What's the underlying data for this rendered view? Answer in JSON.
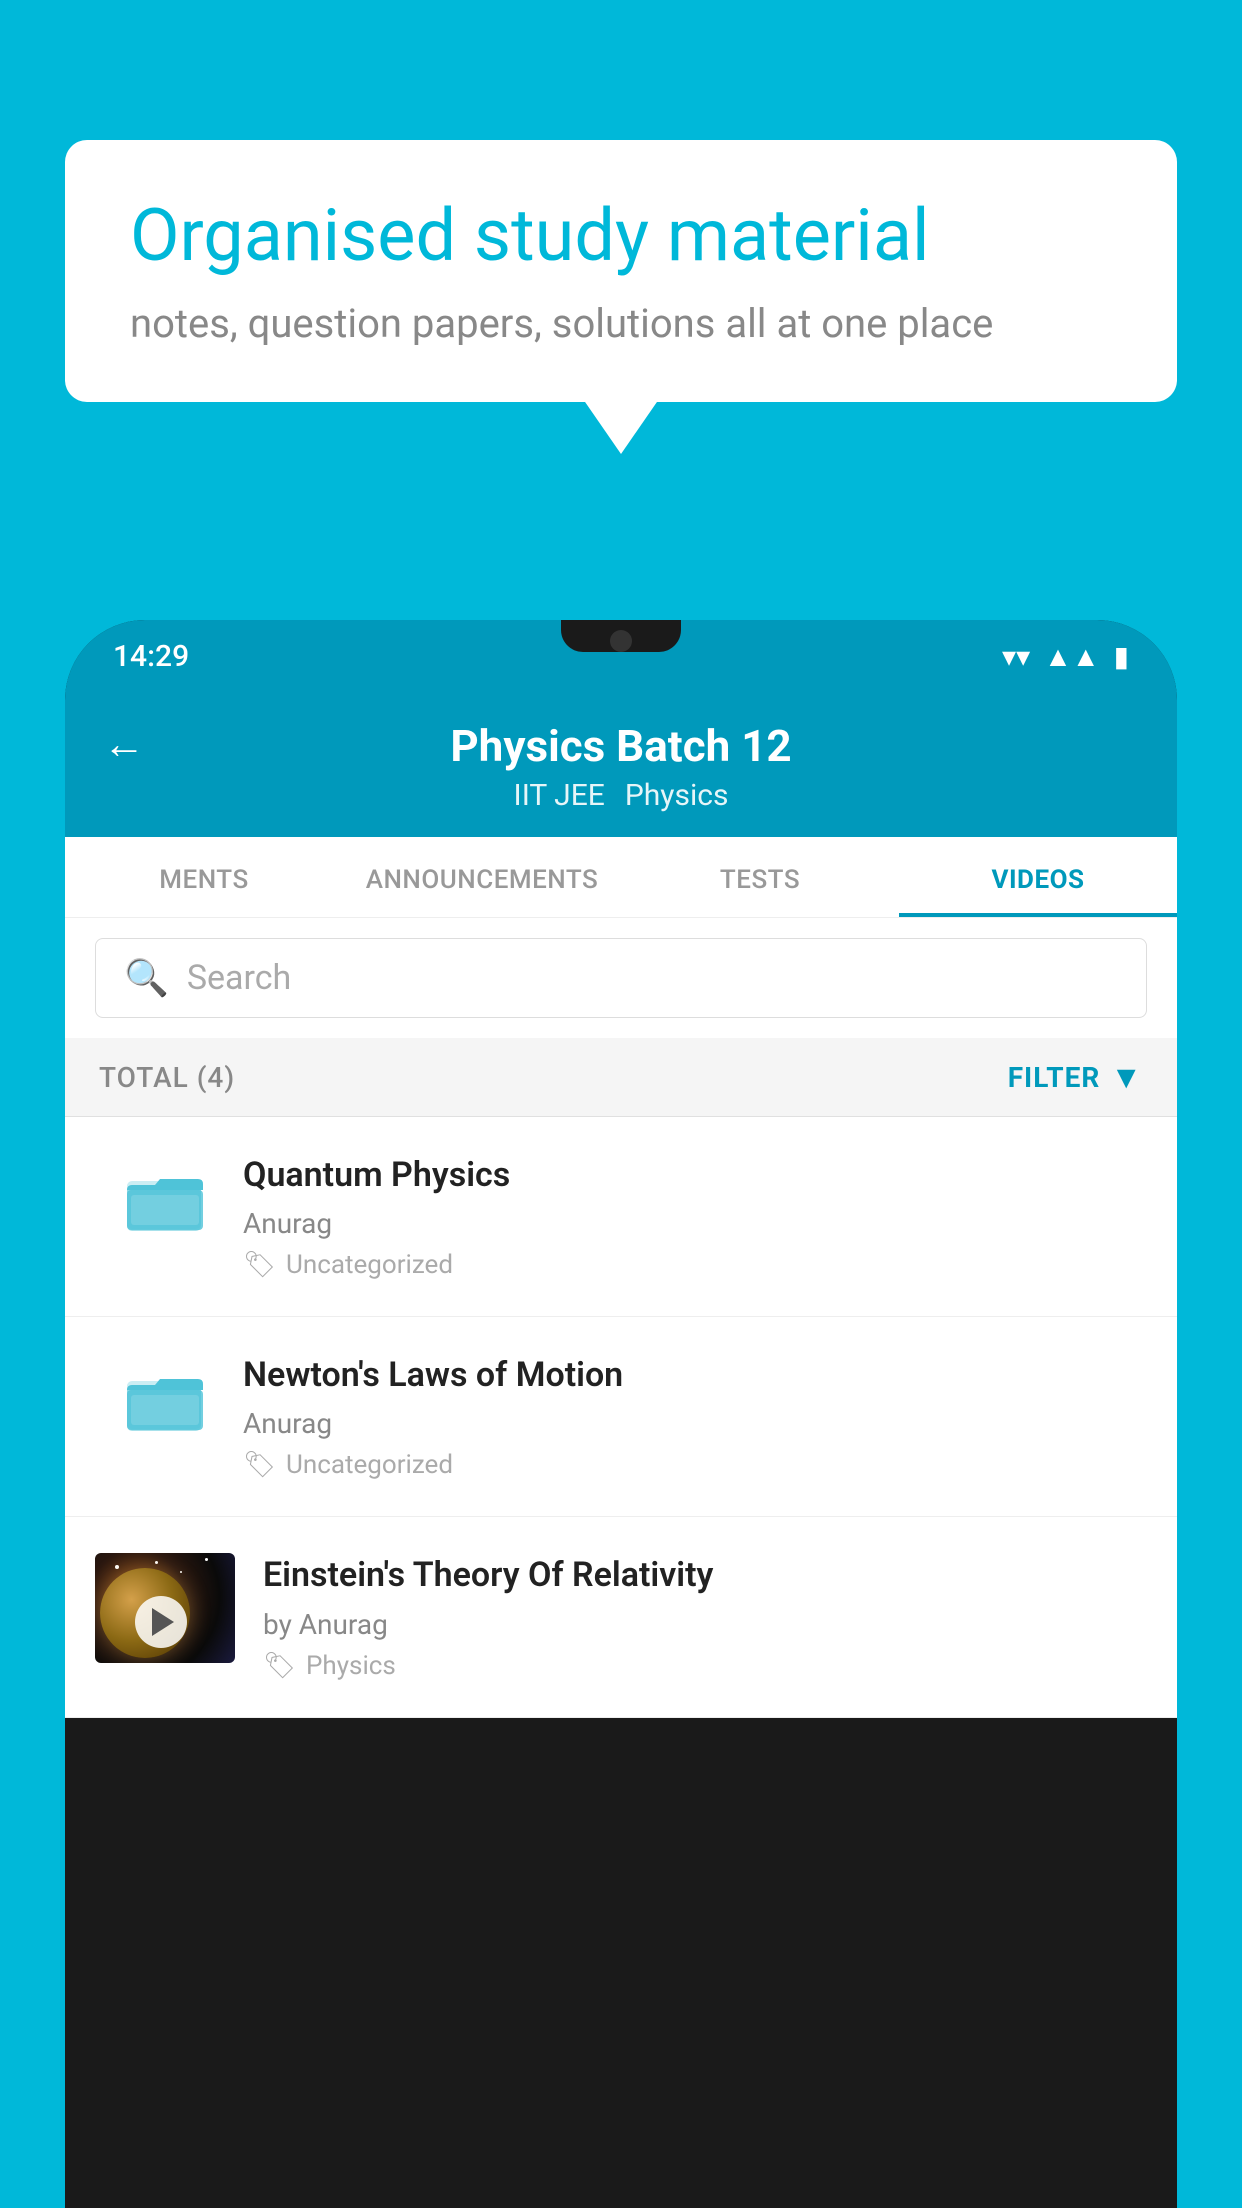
{
  "background_color": "#00B8D9",
  "speech_bubble": {
    "heading": "Organised study material",
    "subtext": "notes, question papers, solutions all at one place"
  },
  "status_bar": {
    "time": "14:29",
    "wifi": "▾",
    "signal": "▴",
    "battery": "▮"
  },
  "app_header": {
    "back_label": "←",
    "title": "Physics Batch 12",
    "subtitle_part1": "IIT JEE",
    "subtitle_part2": "Physics"
  },
  "tabs": [
    {
      "label": "MENTS",
      "active": false
    },
    {
      "label": "ANNOUNCEMENTS",
      "active": false
    },
    {
      "label": "TESTS",
      "active": false
    },
    {
      "label": "VIDEOS",
      "active": true
    }
  ],
  "search": {
    "placeholder": "Search"
  },
  "filter_bar": {
    "total_label": "TOTAL (4)",
    "filter_label": "FILTER"
  },
  "videos": [
    {
      "id": "quantum",
      "title": "Quantum Physics",
      "author": "Anurag",
      "tag": "Uncategorized",
      "type": "folder",
      "has_thumb": false
    },
    {
      "id": "newton",
      "title": "Newton's Laws of Motion",
      "author": "Anurag",
      "tag": "Uncategorized",
      "type": "folder",
      "has_thumb": false
    },
    {
      "id": "einstein",
      "title": "Einstein's Theory Of Relativity",
      "author": "by Anurag",
      "tag": "Physics",
      "type": "video",
      "has_thumb": true
    }
  ]
}
